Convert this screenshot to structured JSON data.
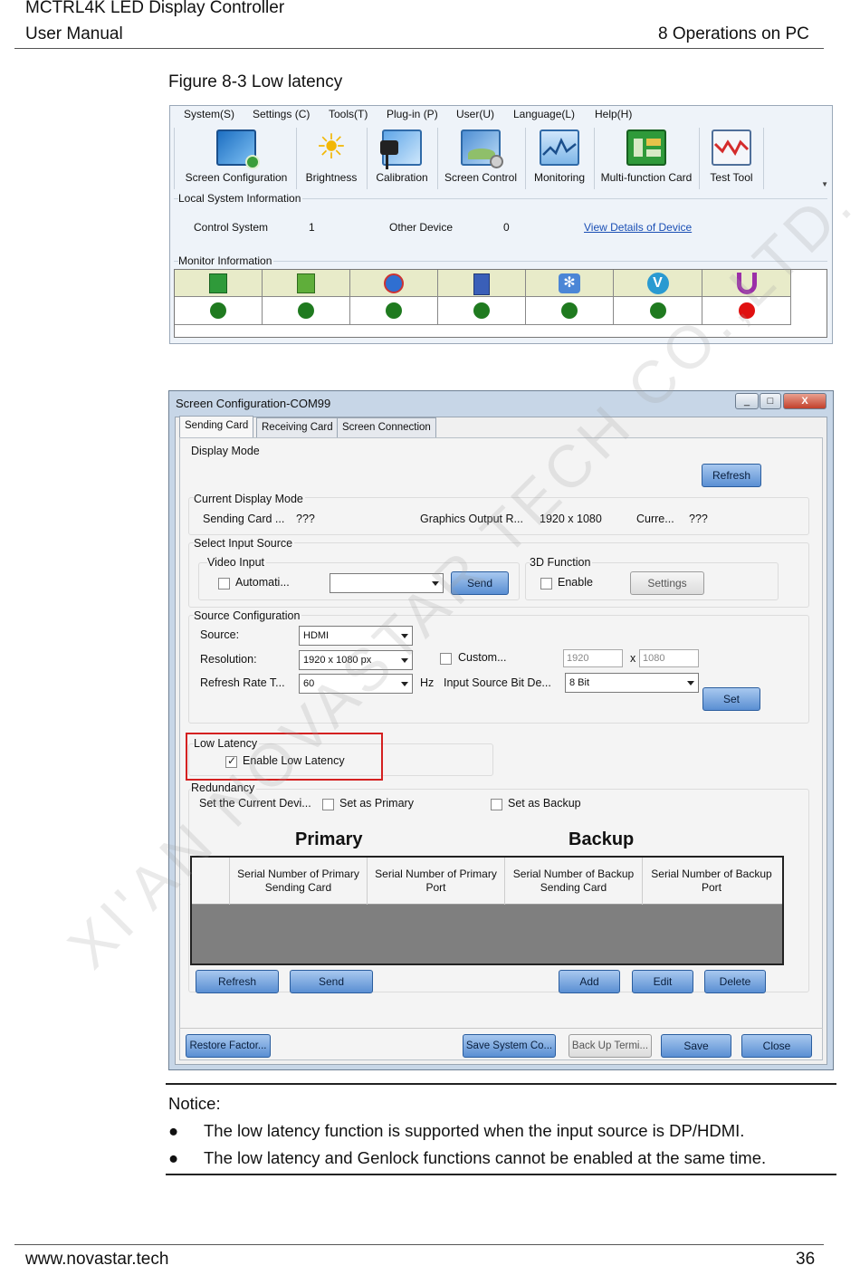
{
  "header": {
    "product": "MCTRL4K LED Display Controller",
    "doc": "User Manual",
    "section": "8 Operations on PC"
  },
  "figure_caption": "Figure 8-3 Low latency",
  "main_window": {
    "menu": [
      "System(S)",
      "Settings (C)",
      "Tools(T)",
      "Plug-in (P)",
      "User(U)",
      "Language(L)",
      "Help(H)"
    ],
    "toolbar": [
      {
        "label": "Screen Configuration",
        "icon": "screen-configuration-icon"
      },
      {
        "label": "Brightness",
        "icon": "brightness-icon"
      },
      {
        "label": "Calibration",
        "icon": "calibration-icon"
      },
      {
        "label": "Screen Control",
        "icon": "screen-control-icon"
      },
      {
        "label": "Monitoring",
        "icon": "monitoring-icon"
      },
      {
        "label": "Multi-function Card",
        "icon": "multi-function-card-icon"
      },
      {
        "label": "Test Tool",
        "icon": "test-tool-icon"
      }
    ],
    "local_info": {
      "title": "Local System Information",
      "control_system_label": "Control System",
      "control_system_value": "1",
      "other_device_label": "Other Device",
      "other_device_value": "0",
      "view_details": "View Details of Device"
    },
    "monitor": {
      "title": "Monitor Information",
      "status_colors": [
        "#1f7a1f",
        "#1f7a1f",
        "#1f7a1f",
        "#1f7a1f",
        "#1f7a1f",
        "#1f7a1f",
        "#e01010"
      ]
    }
  },
  "config_window": {
    "title": "Screen Configuration-COM99",
    "caption_buttons": [
      "_",
      "□",
      "X"
    ],
    "tabs": [
      "Sending Card",
      "Receiving Card",
      "Screen Connection"
    ],
    "display_mode": "Display Mode",
    "refresh": "Refresh",
    "current_display_mode": {
      "title": "Current Display Mode",
      "sending_card_label": "Sending Card ...",
      "sending_card_value": "???",
      "graphics_label": "Graphics Output R...",
      "graphics_value": "1920 x 1080",
      "current_label": "Curre...",
      "current_value": "???"
    },
    "select_input": {
      "title": "Select Input Source",
      "video_input": "Video Input",
      "automatic": "Automati...",
      "send": "Send",
      "function_3d": "3D Function",
      "enable": "Enable",
      "settings": "Settings"
    },
    "source_config": {
      "title": "Source Configuration",
      "source_label": "Source:",
      "source_value": "HDMI",
      "resolution_label": "Resolution:",
      "resolution_value": "1920 x 1080 px",
      "refresh_label": "Refresh Rate T...",
      "refresh_value": "60",
      "hz": "Hz",
      "custom": "Custom...",
      "width": "1920",
      "x": "x",
      "height": "1080",
      "bit_label": "Input Source Bit De...",
      "bit_value": "8 Bit",
      "set": "Set"
    },
    "low_latency": {
      "title": "Low Latency",
      "enable": "Enable Low Latency",
      "checked": true
    },
    "redundancy": {
      "title": "Redundancy",
      "set_current": "Set the Current Devi...",
      "set_primary": "Set as Primary",
      "set_backup": "Set as Backup",
      "primary": "Primary",
      "backup": "Backup",
      "columns": [
        "Serial Number of Primary Sending Card",
        "Serial Number of Primary Port",
        "Serial Number of Backup Sending Card",
        "Serial Number of Backup Port"
      ],
      "buttons": [
        "Refresh",
        "Send",
        "Add",
        "Edit",
        "Delete"
      ]
    },
    "footer_buttons": [
      "Restore Factor...",
      "Save System Co...",
      "Back Up Termi...",
      "Save",
      "Close"
    ]
  },
  "notice": {
    "title": "Notice:",
    "items": [
      "The low latency function is supported when the input source is DP/HDMI.",
      "The low latency and Genlock functions cannot be enabled at the same time."
    ]
  },
  "footer": {
    "website": "www.novastar.tech",
    "page": "36"
  },
  "watermark": "XI'AN NOVASTAR TECH CO.,LTD."
}
